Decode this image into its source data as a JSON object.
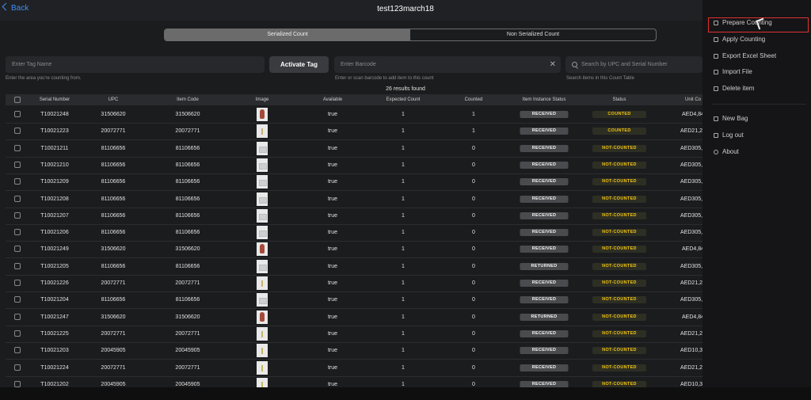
{
  "header": {
    "back_label": "Back",
    "title": "test123march18"
  },
  "segments": {
    "serialized": "Serialized Count",
    "non_serialized": "Non Serialized Count"
  },
  "tag": {
    "placeholder": "Enter Tag Name",
    "hint": "Enter the area you're counting from.",
    "activate_label": "Activate Tag"
  },
  "barcode": {
    "placeholder": "Enter Barcode",
    "hint": "Enter or scan barcode to add item to this count"
  },
  "search": {
    "placeholder": "Search by UPC and Serial Number",
    "hint": "Search items in this Count Table"
  },
  "results_text": "26 results found",
  "table": {
    "columns": [
      "Serial Number",
      "UPC",
      "Item Code",
      "Image",
      "Available",
      "Expected Count",
      "Counted",
      "Item Instance Status",
      "Status",
      "Unit Co"
    ],
    "rows": [
      {
        "serial": "T10021248",
        "upc": "31506620",
        "code": "31506620",
        "image": "vase",
        "available": "true",
        "expected": "1",
        "counted": "1",
        "instance": "RECEIVED",
        "status": "COUNTED",
        "unit": "AED4,84"
      },
      {
        "serial": "T10021223",
        "upc": "20072771",
        "code": "20072771",
        "image": "bottle",
        "available": "true",
        "expected": "1",
        "counted": "1",
        "instance": "RECEIVED",
        "status": "COUNTED",
        "unit": "AED21,22"
      },
      {
        "serial": "T10021211",
        "upc": "81106656",
        "code": "81106656",
        "image": "box",
        "available": "true",
        "expected": "1",
        "counted": "0",
        "instance": "RECEIVED",
        "status": "NOT-COUNTED",
        "unit": "AED305,0"
      },
      {
        "serial": "T10021210",
        "upc": "81106656",
        "code": "81106656",
        "image": "box",
        "available": "true",
        "expected": "1",
        "counted": "0",
        "instance": "RECEIVED",
        "status": "NOT-COUNTED",
        "unit": "AED305,0"
      },
      {
        "serial": "T10021209",
        "upc": "81106656",
        "code": "81106656",
        "image": "box",
        "available": "true",
        "expected": "1",
        "counted": "0",
        "instance": "RECEIVED",
        "status": "NOT-COUNTED",
        "unit": "AED305,0"
      },
      {
        "serial": "T10021208",
        "upc": "81106656",
        "code": "81106656",
        "image": "box",
        "available": "true",
        "expected": "1",
        "counted": "0",
        "instance": "RECEIVED",
        "status": "NOT-COUNTED",
        "unit": "AED305,0"
      },
      {
        "serial": "T10021207",
        "upc": "81106656",
        "code": "81106656",
        "image": "box",
        "available": "true",
        "expected": "1",
        "counted": "0",
        "instance": "RECEIVED",
        "status": "NOT-COUNTED",
        "unit": "AED305,0"
      },
      {
        "serial": "T10021206",
        "upc": "81106656",
        "code": "81106656",
        "image": "box",
        "available": "true",
        "expected": "1",
        "counted": "0",
        "instance": "RECEIVED",
        "status": "NOT-COUNTED",
        "unit": "AED305,0"
      },
      {
        "serial": "T10021249",
        "upc": "31506620",
        "code": "31506620",
        "image": "vase",
        "available": "true",
        "expected": "1",
        "counted": "0",
        "instance": "RECEIVED",
        "status": "NOT-COUNTED",
        "unit": "AED4,84"
      },
      {
        "serial": "T10021205",
        "upc": "81106656",
        "code": "81106656",
        "image": "box",
        "available": "true",
        "expected": "1",
        "counted": "0",
        "instance": "RETURNED",
        "status": "NOT-COUNTED",
        "unit": "AED305,0"
      },
      {
        "serial": "T10021226",
        "upc": "20072771",
        "code": "20072771",
        "image": "bottle",
        "available": "true",
        "expected": "1",
        "counted": "0",
        "instance": "RECEIVED",
        "status": "NOT-COUNTED",
        "unit": "AED21,22"
      },
      {
        "serial": "T10021204",
        "upc": "81106656",
        "code": "81106656",
        "image": "box",
        "available": "true",
        "expected": "1",
        "counted": "0",
        "instance": "RECEIVED",
        "status": "NOT-COUNTED",
        "unit": "AED305,0"
      },
      {
        "serial": "T10021247",
        "upc": "31506620",
        "code": "31506620",
        "image": "vase",
        "available": "true",
        "expected": "1",
        "counted": "0",
        "instance": "RETURNED",
        "status": "NOT-COUNTED",
        "unit": "AED4,84"
      },
      {
        "serial": "T10021225",
        "upc": "20072771",
        "code": "20072771",
        "image": "bottle",
        "available": "true",
        "expected": "1",
        "counted": "0",
        "instance": "RECEIVED",
        "status": "NOT-COUNTED",
        "unit": "AED21,22"
      },
      {
        "serial": "T10021203",
        "upc": "20045905",
        "code": "20045905",
        "image": "bottle",
        "available": "true",
        "expected": "1",
        "counted": "0",
        "instance": "RECEIVED",
        "status": "NOT-COUNTED",
        "unit": "AED10,38"
      },
      {
        "serial": "T10021224",
        "upc": "20072771",
        "code": "20072771",
        "image": "bottle",
        "available": "true",
        "expected": "1",
        "counted": "0",
        "instance": "RECEIVED",
        "status": "NOT-COUNTED",
        "unit": "AED21,22"
      },
      {
        "serial": "T10021202",
        "upc": "20045905",
        "code": "20045905",
        "image": "bottle",
        "available": "true",
        "expected": "1",
        "counted": "0",
        "instance": "RECEIVED",
        "status": "NOT-COUNTED",
        "unit": "AED10,38"
      }
    ]
  },
  "menu": {
    "items": [
      "Prepare Counting",
      "Apply Counting",
      "Export Excel Sheet",
      "Import File",
      "Delete item"
    ],
    "items2": [
      "New Bag",
      "Log out",
      "About"
    ]
  },
  "colors": {
    "accent": "#3e8ef7",
    "warning": "#f1c40f",
    "highlight": "#e03131"
  }
}
